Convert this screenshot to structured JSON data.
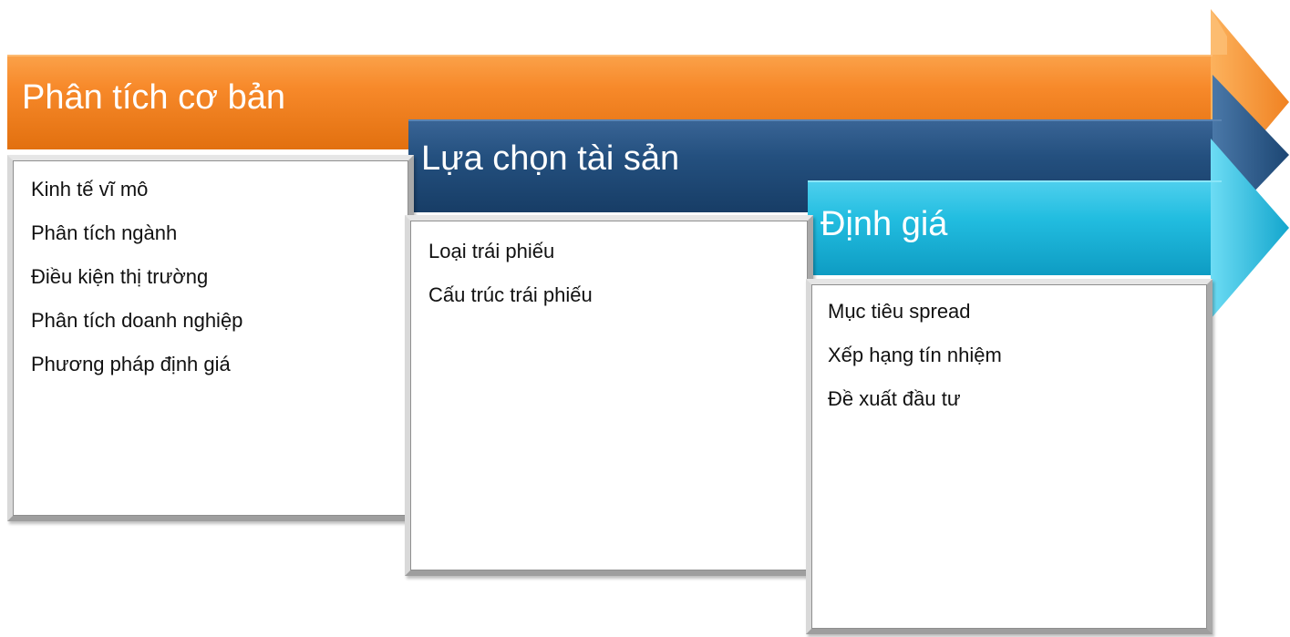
{
  "stages": [
    {
      "title": "Phân tích cơ bản",
      "color": "#f58220",
      "items": [
        "Kinh tế vĩ mô",
        "Phân tích ngành",
        "Điều kiện thị trường",
        "Phân tích doanh nghiệp",
        "Phương pháp định giá"
      ]
    },
    {
      "title": "Lựa chọn tài sản",
      "color": "#1f4e79",
      "items": [
        "Loại trái phiếu",
        "Cấu trúc trái phiếu"
      ]
    },
    {
      "title": "Định giá",
      "color": "#19b3d6",
      "items": [
        "Mục tiêu spread",
        "Xếp hạng tín nhiệm",
        "Đề xuất đầu tư"
      ]
    }
  ]
}
